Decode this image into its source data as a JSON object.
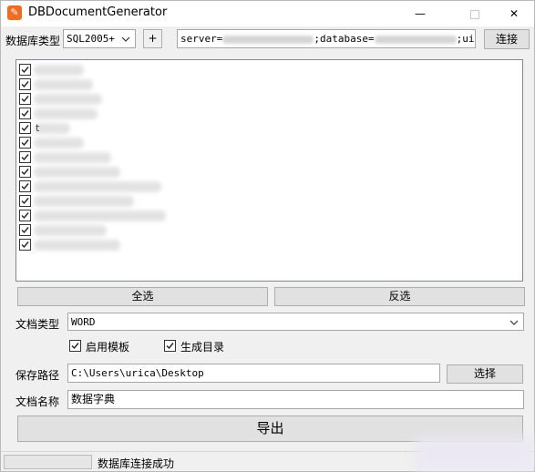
{
  "window": {
    "title": "DBDocumentGenerator",
    "icon": "document-generator-icon",
    "minimize": "—",
    "close": "✕"
  },
  "connection": {
    "db_type_label": "数据库类型",
    "db_type_value": "SQL2005+",
    "add_label": "+",
    "conn_prefix": "server=",
    "conn_mid": ";database=",
    "conn_suffix": ";uid=",
    "connect_label": "连接"
  },
  "tables": {
    "items": [
      {
        "checked": true,
        "label": "",
        "blur_width": 55
      },
      {
        "checked": true,
        "label": "",
        "blur_width": 65
      },
      {
        "checked": true,
        "label": "",
        "blur_width": 75
      },
      {
        "checked": true,
        "label": "",
        "blur_width": 70
      },
      {
        "checked": true,
        "label": "t",
        "blur_width": 40
      },
      {
        "checked": true,
        "label": "",
        "blur_width": 55
      },
      {
        "checked": true,
        "label": "",
        "blur_width": 85
      },
      {
        "checked": true,
        "label": "",
        "blur_width": 95
      },
      {
        "checked": true,
        "label": "",
        "blur_width": 140
      },
      {
        "checked": true,
        "label": "",
        "blur_width": 110
      },
      {
        "checked": true,
        "label": "",
        "blur_width": 145
      },
      {
        "checked": true,
        "label": "",
        "blur_width": 80
      },
      {
        "checked": true,
        "label": "",
        "blur_width": 95
      }
    ]
  },
  "actions": {
    "select_all": "全选",
    "invert": "反选"
  },
  "document": {
    "type_label": "文档类型",
    "type_value": "WORD",
    "use_template_label": "启用模板",
    "use_template_checked": true,
    "gen_toc_label": "生成目录",
    "gen_toc_checked": true,
    "save_path_label": "保存路径",
    "save_path_value": "C:\\Users\\urica\\Desktop",
    "choose_label": "选择",
    "name_label": "文档名称",
    "name_value": "数据字典"
  },
  "export": {
    "label": "导出"
  },
  "status": {
    "text": "数据库连接成功"
  }
}
